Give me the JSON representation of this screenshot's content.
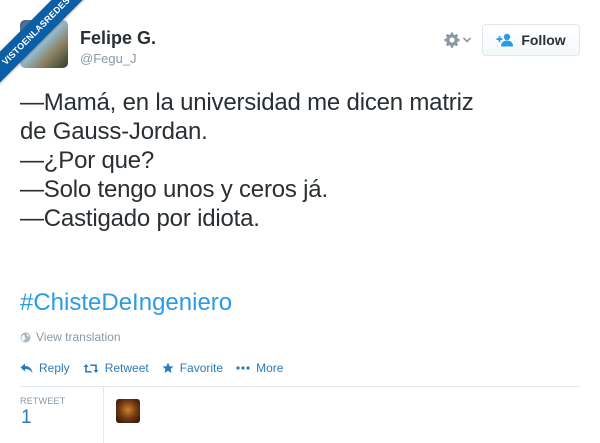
{
  "watermark": {
    "text": "VISTOENLASREDES"
  },
  "user": {
    "name": "Felipe G.",
    "handle": "@Fegu_J"
  },
  "header": {
    "settings_icon": "gear-icon",
    "follow_label": "Follow"
  },
  "tweet": {
    "lines": [
      "—Mamá, en la universidad me dicen matriz",
      "de Gauss-Jordan.",
      "—¿Por que?",
      "—Solo tengo unos y ceros já.",
      "—Castigado por idiota."
    ],
    "hashtag": "#ChisteDeIngeniero",
    "view_translation": "View translation"
  },
  "actions": {
    "reply": "Reply",
    "retweet": "Retweet",
    "favorite": "Favorite",
    "more": "More"
  },
  "stats": {
    "retweet_label": "RETWEET",
    "retweet_count": "1"
  },
  "colors": {
    "link": "#2b7bb9",
    "hashtag": "#2b9ce3",
    "muted": "#8899a6",
    "text": "#292f33",
    "ribbon": "#0b5fa6"
  }
}
